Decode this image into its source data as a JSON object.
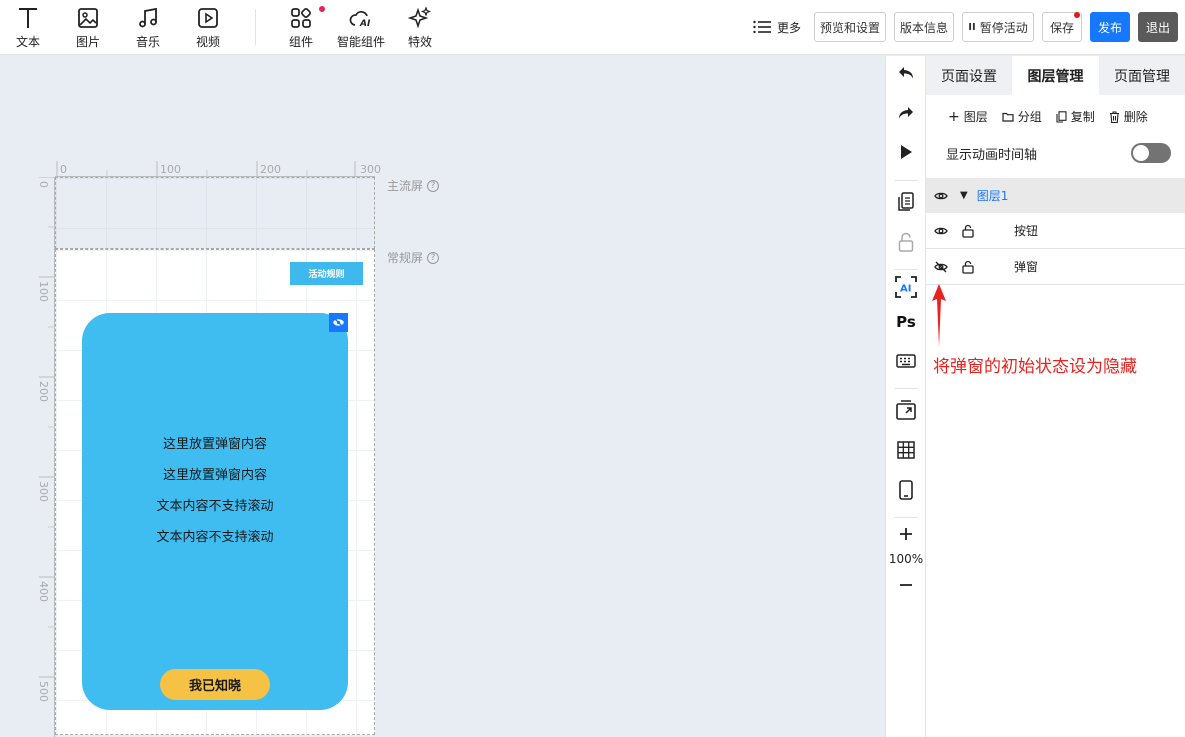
{
  "toolbar": {
    "tools": [
      {
        "label": "文本",
        "icon": "text-icon"
      },
      {
        "label": "图片",
        "icon": "image-icon"
      },
      {
        "label": "音乐",
        "icon": "music-icon"
      },
      {
        "label": "视频",
        "icon": "video-icon"
      },
      {
        "label": "组件",
        "icon": "components-icon"
      },
      {
        "label": "智能组件",
        "icon": "ai-cloud-icon"
      },
      {
        "label": "特效",
        "icon": "sparkle-icon"
      }
    ],
    "more_label": "更多",
    "preview_label": "预览和设置",
    "version_label": "版本信息",
    "pause_label": "暂停活动",
    "save_label": "保存",
    "publish_label": "发布",
    "exit_label": "退出",
    "publish_color": "#1677ff",
    "badge_color": "#e6245c"
  },
  "canvas": {
    "ruler_h": [
      "0",
      "100",
      "200",
      "300"
    ],
    "ruler_v": [
      "0",
      "100",
      "200",
      "300",
      "400",
      "500"
    ],
    "main_screen_label": "主流屏",
    "normal_screen_label": "常规屏",
    "rule_button_label": "活动规则",
    "popup": {
      "lines": [
        "这里放置弹窗内容",
        "这里放置弹窗内容",
        "文本内容不支持滚动",
        "文本内容不支持滚动"
      ],
      "button_label": "我已知晓",
      "color": "#3fbcf0",
      "button_color": "#f5c243"
    }
  },
  "vbar": {
    "icons": [
      "undo-icon",
      "redo-icon",
      "play-icon",
      "copy-pages-icon",
      "lock-icon",
      "ai-scan-icon",
      "ps-icon",
      "keyboard-icon",
      "replace-screen-icon",
      "grid-icon",
      "mobile-icon",
      "zoom-in-icon",
      "zoom-out-icon"
    ],
    "ai_label": "AI",
    "ps_label": "Ps",
    "zoom": "100%"
  },
  "panel": {
    "tabs": [
      "页面设置",
      "图层管理",
      "页面管理"
    ],
    "active_tab": 1,
    "actions": {
      "add_layer": "图层",
      "group": "分组",
      "copy": "复制",
      "delete": "删除"
    },
    "anim_toggle_label": "显示动画时间轴",
    "anim_toggle_on": false,
    "layer_group": "图层1",
    "layers": [
      {
        "name": "按钮",
        "visible": true
      },
      {
        "name": "弹窗",
        "visible": false
      }
    ]
  },
  "annotation": {
    "text": "将弹窗的初始状态设为隐藏",
    "color": "#e8231f"
  }
}
